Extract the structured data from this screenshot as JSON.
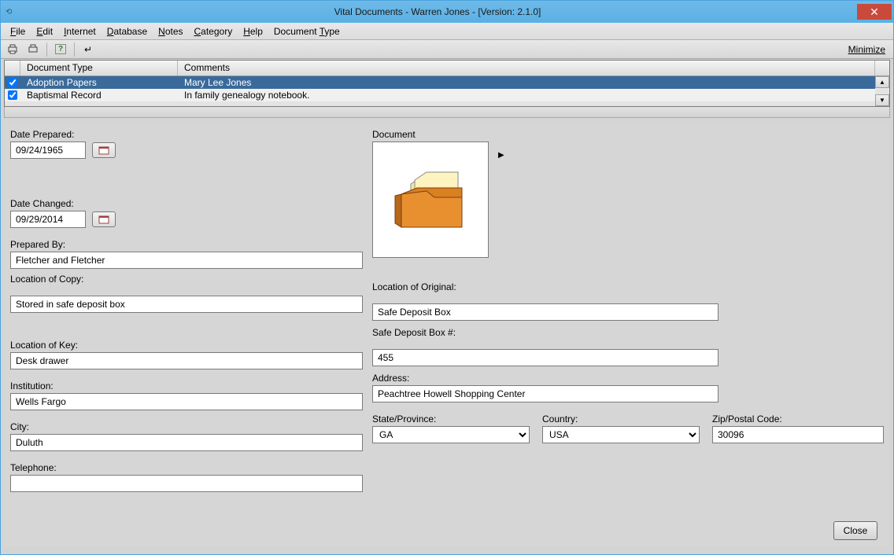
{
  "title": "Vital Documents - Warren Jones - [Version: 2.1.0]",
  "menubar": [
    "File",
    "Edit",
    "Internet",
    "Database",
    "Notes",
    "Category",
    "Help",
    "Document Type"
  ],
  "toolbar": {
    "minimize_label": "Minimize"
  },
  "grid": {
    "headers": {
      "doctype": "Document Type",
      "comments": "Comments"
    },
    "rows": [
      {
        "checked": true,
        "doctype": "Adoption Papers",
        "comments": "Mary Lee Jones",
        "selected": true
      },
      {
        "checked": true,
        "doctype": "Baptismal Record",
        "comments": "In family genealogy notebook.",
        "selected": false
      }
    ]
  },
  "form": {
    "labels": {
      "date_prepared": "Date Prepared:",
      "date_changed": "Date Changed:",
      "prepared_by": "Prepared By:",
      "location_copy": "Location of Copy:",
      "location_key": "Location of Key:",
      "institution": "Institution:",
      "city": "City:",
      "telephone": "Telephone:",
      "document": "Document",
      "location_original": "Location of Original:",
      "safe_box": "Safe Deposit Box #:",
      "address": "Address:",
      "state": "State/Province:",
      "country": "Country:",
      "zip": "Zip/Postal Code:"
    },
    "values": {
      "date_prepared": "09/24/1965",
      "date_changed": "09/29/2014",
      "prepared_by": "Fletcher and Fletcher",
      "location_copy": "Stored in safe deposit box",
      "location_key": "Desk drawer",
      "institution": "Wells Fargo",
      "city": "Duluth",
      "telephone": "",
      "location_original": "Safe Deposit Box",
      "safe_box": "455",
      "address": "Peachtree Howell Shopping Center",
      "state": "GA",
      "country": "USA",
      "zip": "30096"
    }
  },
  "close_label": "Close"
}
